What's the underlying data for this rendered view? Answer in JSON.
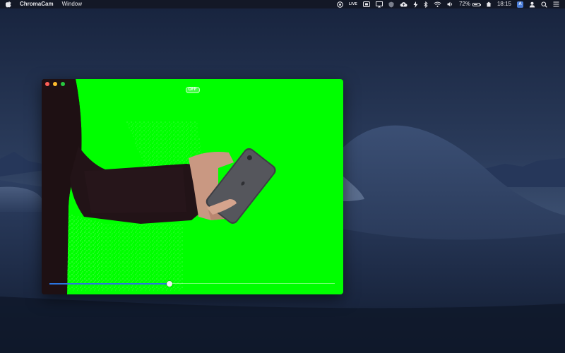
{
  "menubar": {
    "app_name": "ChromaCam",
    "menus": [
      "Window"
    ],
    "status_tiny_label": "LIVE",
    "battery_percent": "72%",
    "battery_level": 0.72,
    "clock": "18:15",
    "input_badge": "A"
  },
  "window": {
    "title_pill": "OFF",
    "slider_value": 0.42
  },
  "colors": {
    "green_screen": "#00ff00",
    "slider_accent": "#2b74e0",
    "menubar_bg": "#14182a"
  }
}
